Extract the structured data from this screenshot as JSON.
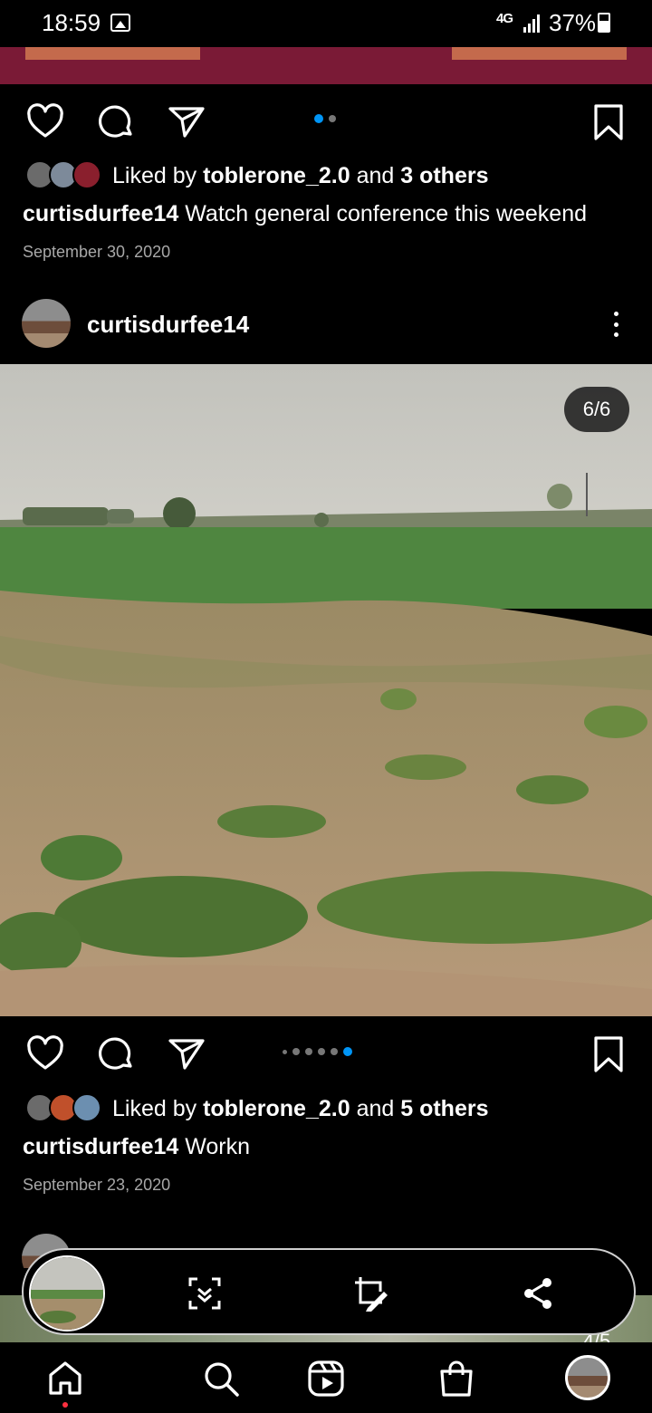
{
  "status_bar": {
    "time": "18:59",
    "network": "4G",
    "battery": "37%"
  },
  "post1": {
    "liked_by_prefix": "Liked by ",
    "liked_by_user": "toblerone_2.0",
    "liked_by_and": " and ",
    "liked_by_others": "3 others",
    "caption_user": "curtisdurfee14",
    "caption_text": " Watch general conference this weekend",
    "date": "September 30, 2020",
    "carousel_dots": 2,
    "carousel_active": 1
  },
  "post2": {
    "username": "curtisdurfee14",
    "image_counter": "6/6",
    "liked_by_prefix": "Liked by ",
    "liked_by_user": "toblerone_2.0",
    "liked_by_and": " and ",
    "liked_by_others": "5 others",
    "caption_user": "curtisdurfee14",
    "caption_text": " Workn",
    "date": "September 23, 2020",
    "carousel_dots": 6,
    "carousel_active": 6
  },
  "post3": {
    "image_counter": "4/5"
  },
  "floating_bar": {
    "icons": [
      "screenshot-scroll-icon",
      "edit-crop-icon",
      "share-icon"
    ]
  },
  "bottom_nav": {
    "items": [
      "home-icon",
      "search-icon",
      "reels-icon",
      "shop-icon",
      "profile-avatar"
    ]
  },
  "colors": {
    "accent": "#0095f6",
    "notification": "#ff3040",
    "background": "#000000",
    "secondary_text": "#a8a8a8"
  }
}
